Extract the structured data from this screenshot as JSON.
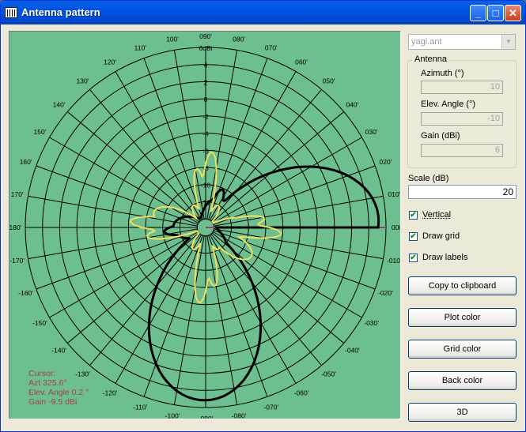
{
  "window": {
    "title": "Antenna pattern"
  },
  "titlebar": {
    "minimize": "_",
    "maximize": "□",
    "close": "✕"
  },
  "file_select": {
    "value": "yagi.ant"
  },
  "antenna_group": {
    "title": "Antenna",
    "azimuth_label": "Azimuth (°)",
    "azimuth_value": "10",
    "elev_label": "Elev. Angle (°)",
    "elev_value": "-10",
    "gain_label": "Gain (dBi)",
    "gain_value": "6"
  },
  "scale": {
    "label": "Scale (dB)",
    "value": "20"
  },
  "options": [
    {
      "label": "Vertical",
      "checked": true
    },
    {
      "label": "Draw grid",
      "checked": true
    },
    {
      "label": "Draw labels",
      "checked": true
    }
  ],
  "buttons": {
    "copy": "Copy to clipboard",
    "plot_color": "Plot color",
    "grid_color": "Grid color",
    "back_color": "Back color",
    "threed": "3D"
  },
  "cursor": {
    "title": "Cursor:",
    "azt": "Azt 325.6°",
    "elev": "Elev. Angle 0.2 °",
    "gain": "Gain -9.5 dBi"
  },
  "plot": {
    "background": "#6ebf8f",
    "grid_color": "#000000",
    "azimuth_pattern_color": "#000000",
    "elevation_pattern_color": "#f0e060",
    "cursor_line_color": "#9a3c82",
    "angle_labels_upper": [
      "000",
      "010'",
      "020'",
      "030'",
      "040'",
      "050'",
      "060'",
      "070'",
      "080'",
      "090'",
      "100'",
      "110'",
      "120'",
      "130'",
      "140'",
      "150'",
      "160'",
      "170'",
      "-180'"
    ],
    "angle_labels_lower": [
      "-170'",
      "-160'",
      "-150'",
      "-140'",
      "-130'",
      "-120'",
      "-110'",
      "-100'",
      "-090'",
      "-080'",
      "-070'",
      "-060'",
      "-050'",
      "-040'",
      "-030'",
      "-020'",
      "-010'"
    ],
    "radial_labels": [
      "6dBi",
      "4",
      "2",
      "0",
      "-2",
      "-4",
      "-6",
      "-8",
      "-10",
      "-12"
    ],
    "max_gain_dbi": 6,
    "scale_db": 20
  }
}
